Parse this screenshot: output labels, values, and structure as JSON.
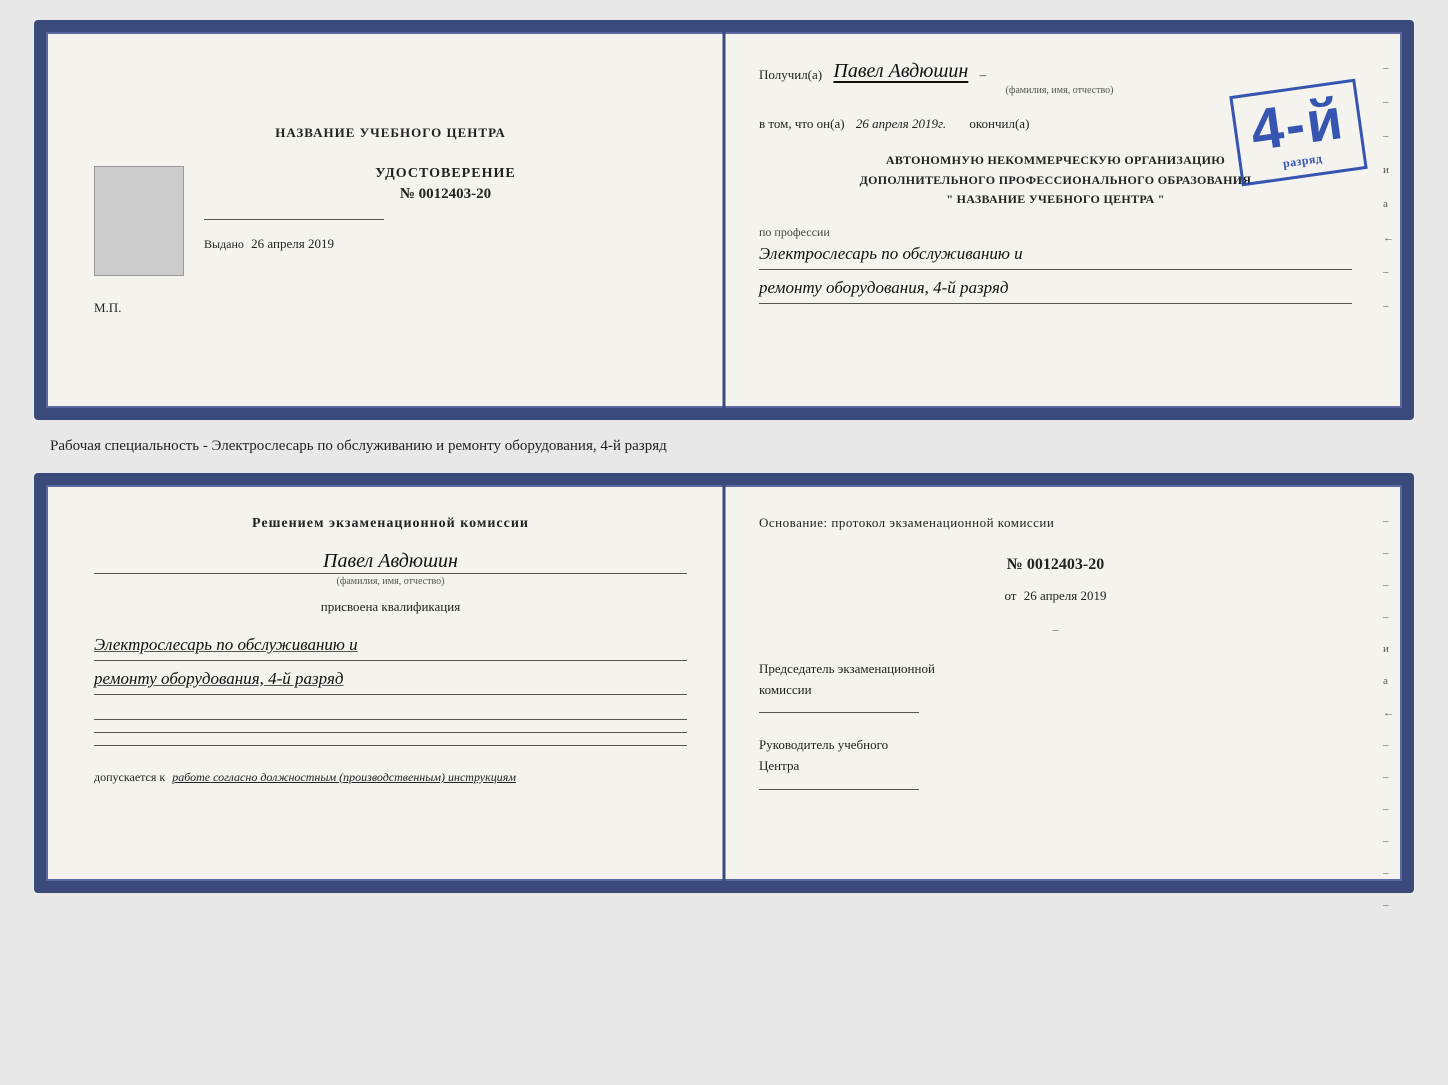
{
  "top_card": {
    "left": {
      "center_title": "НАЗВАНИЕ УЧЕБНОГО ЦЕНТРА",
      "udostoverenie_label": "УДОСТОВЕРЕНИЕ",
      "number": "№ 0012403-20",
      "vydano_label": "Выдано",
      "vydano_date": "26 апреля 2019",
      "mp_label": "М.П."
    },
    "right": {
      "poluchil_prefix": "Получил(a)",
      "name_handwritten": "Павел Авдюшин",
      "name_subtitle": "(фамилия, имя, отчество)",
      "vtom_prefix": "в том, что он(а)",
      "date_italic": "26 апреля 2019г.",
      "okonchil": "окончил(а)",
      "stamp_number": "4-й",
      "stamp_rank": "разряд",
      "org_line1": "АВТОНОМНУЮ НЕКОММЕРЧЕСКУЮ ОРГАНИЗАЦИЮ",
      "org_line2": "ДОПОЛНИТЕЛЬНОГО ПРОФЕССИОНАЛЬНОГО ОБРАЗОВАНИЯ",
      "org_name": "\" НАЗВАНИЕ УЧЕБНОГО ЦЕНТРА \"",
      "po_professii": "по профессии",
      "professiya_line1": "Электрослесарь по обслуживанию и",
      "professiya_line2": "ремонту оборудования, 4-й разряд",
      "dash_marks": [
        "-",
        "-",
        "-",
        "и",
        "а",
        "←",
        "-",
        "-"
      ]
    }
  },
  "between_label": {
    "text": "Рабочая специальность - Электрослесарь по обслуживанию и ремонту оборудования, 4-й разряд"
  },
  "bottom_card": {
    "left": {
      "resheniem_text": "Решением экзаменационной комиссии",
      "name_handwritten": "Павел Авдюшин",
      "name_subtitle": "(фамилия, имя, отчество)",
      "prisvoena_text": "присвоена квалификация",
      "kvalifikaciya_line1": "Электрослесарь по обслуживанию и",
      "kvalifikaciya_line2": "ремонту оборудования, 4-й разряд",
      "lines": [
        "_",
        "_",
        "_"
      ],
      "dopuskaetsya_prefix": "допускается к",
      "dopuskaetsya_italic": "работе согласно должностным (производственным) инструкциям"
    },
    "right": {
      "osnovanie_text": "Основание: протокол экзаменационной комиссии",
      "number": "№ 0012403-20",
      "ot_prefix": "от",
      "ot_date": "26 апреля 2019",
      "predsedatel_line1": "Председатель экзаменационной",
      "predsedatel_line2": "комиссии",
      "rukovoditel_line1": "Руководитель учебного",
      "rukovoditel_line2": "Центра",
      "dash_marks": [
        "-",
        "-",
        "-",
        "-",
        "и",
        "а",
        "←",
        "-",
        "-",
        "-",
        "-",
        "-",
        "-"
      ]
    }
  }
}
